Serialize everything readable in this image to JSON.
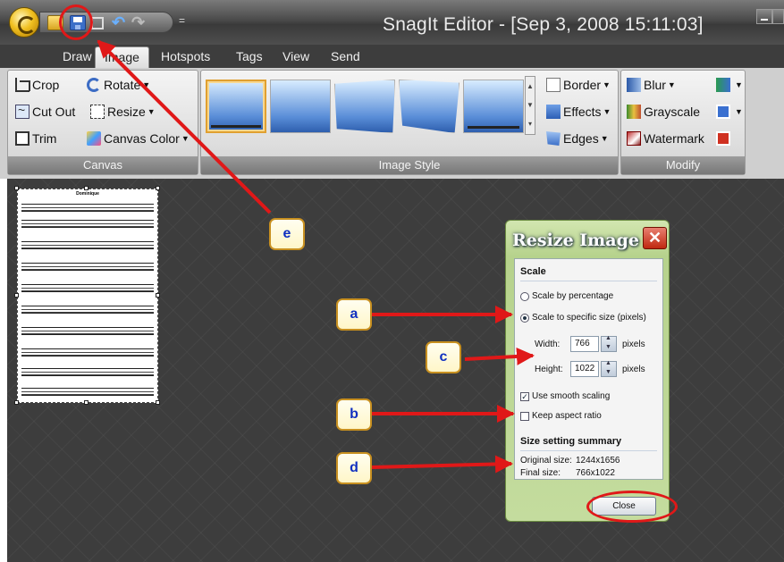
{
  "window": {
    "title": "SnagIt Editor - [Sep 3, 2008 15:11:03]",
    "qat_more": "="
  },
  "tabs": [
    "Draw",
    "Image",
    "Hotspots",
    "Tags",
    "View",
    "Send"
  ],
  "ribbon": {
    "canvas_group": {
      "label": "Canvas",
      "crop": "Crop",
      "rotate": "Rotate",
      "cut_out": "Cut Out",
      "resize": "Resize",
      "trim": "Trim",
      "canvas_color": "Canvas Color"
    },
    "image_style_group": {
      "label": "Image Style",
      "border": "Border",
      "effects": "Effects",
      "edges": "Edges"
    },
    "modify_group": {
      "label": "Modify",
      "blur": "Blur",
      "grayscale": "Grayscale",
      "watermark": "Watermark"
    }
  },
  "document": {
    "title": "Dominique"
  },
  "dialog": {
    "title": "Resize Image",
    "scale_header": "Scale",
    "scale_by_percentage": "Scale by percentage",
    "scale_to_specific": "Scale to specific size (pixels)",
    "width_label": "Width:",
    "width_value": "766",
    "height_label": "Height:",
    "height_value": "1022",
    "units": "pixels",
    "smooth_scaling": "Use smooth scaling",
    "keep_aspect": "Keep aspect ratio",
    "summary_header": "Size setting summary",
    "original_label": "Original size:",
    "original_value": "1244x1656",
    "final_label": "Final size:",
    "final_value": "766x1022",
    "close": "Close",
    "scale_to_specific_selected": true,
    "smooth_scaling_checked": true,
    "keep_aspect_checked": false
  },
  "callouts": {
    "a": "a",
    "b": "b",
    "c": "c",
    "d": "d",
    "e": "e"
  },
  "colors": {
    "annotation_red": "#e01818",
    "callout_border": "#c89020",
    "callout_text": "#1030c0",
    "dialog_green": "#b6d28c"
  }
}
